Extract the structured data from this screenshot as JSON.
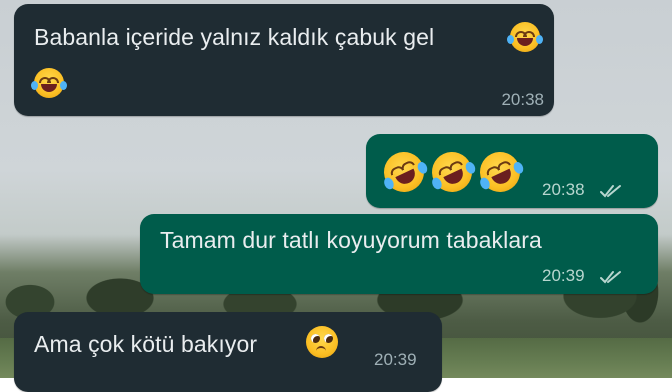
{
  "chat": {
    "messages": [
      {
        "direction": "incoming",
        "text": "Babanla içeride yalnız kaldık çabuk gel",
        "emojis": [
          "face-with-tears-of-joy",
          "face-with-tears-of-joy"
        ],
        "time": "20:38"
      },
      {
        "direction": "outgoing",
        "text": "",
        "emojis": [
          "rolling-on-the-floor-laughing",
          "rolling-on-the-floor-laughing",
          "rolling-on-the-floor-laughing"
        ],
        "time": "20:38",
        "status": "read"
      },
      {
        "direction": "outgoing",
        "text": "Tamam dur tatlı koyuyorum tabaklara",
        "emojis": [],
        "time": "20:39",
        "status": "read"
      },
      {
        "direction": "incoming",
        "text": "Ama çok kötü bakıyor",
        "emojis": [
          "pleading-face"
        ],
        "time": "20:39"
      }
    ]
  },
  "colors": {
    "incoming_bubble": "#1f2c33",
    "outgoing_bubble": "#005c4b",
    "text": "#e9edef",
    "read_ticks": "#b8d6cf"
  }
}
